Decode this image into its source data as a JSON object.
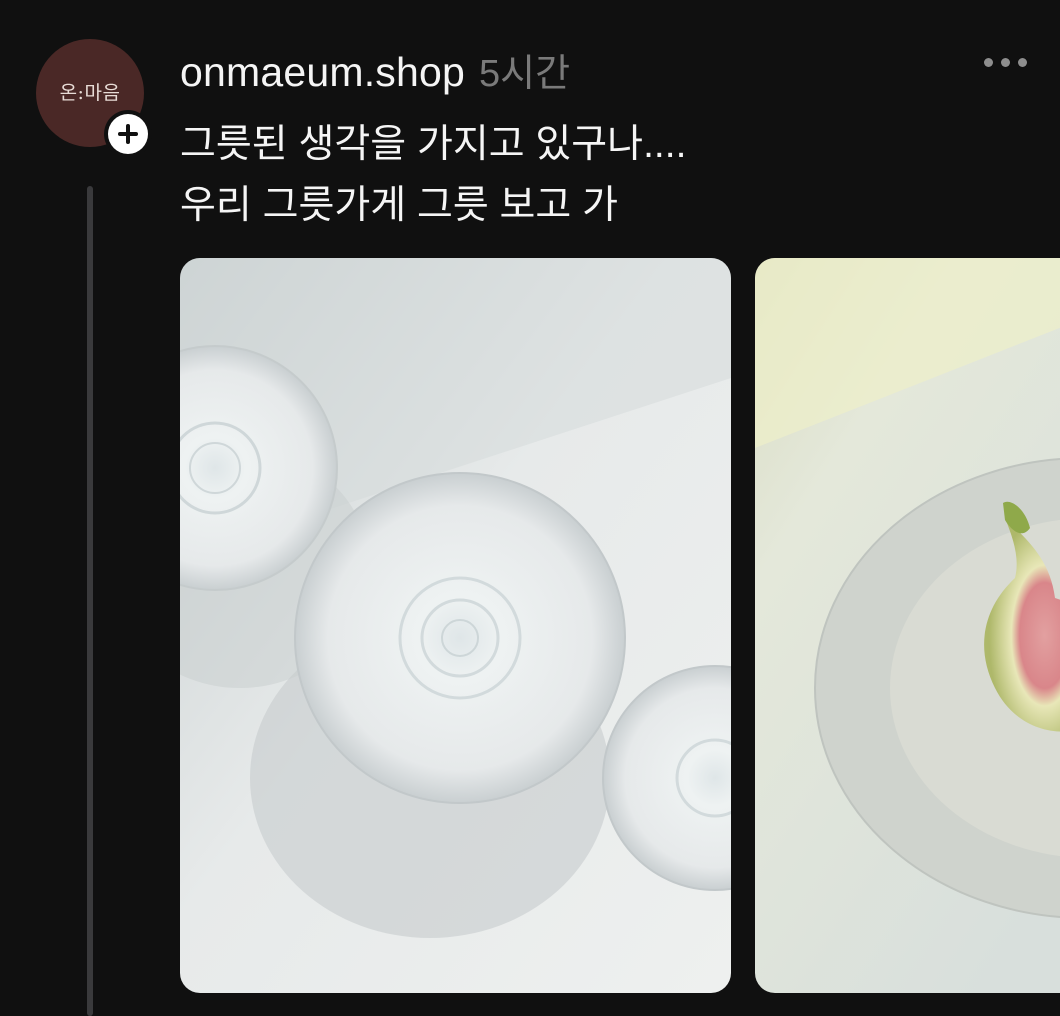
{
  "post": {
    "avatar_text": "온:마음",
    "username": "onmaeum.shop",
    "time": "5시간",
    "text_lines": [
      "그릇된 생각을 가지고 있구나....",
      "우리 그릇가게 그릇 보고 가"
    ],
    "images": [
      {
        "description_icon": "white-plates-photo"
      },
      {
        "description_icon": "fig-on-plate-photo"
      }
    ]
  },
  "colors": {
    "background": "#101010",
    "avatar_bg": "#4a2826",
    "text": "#f5f5f5",
    "muted": "#7a7a7a"
  }
}
